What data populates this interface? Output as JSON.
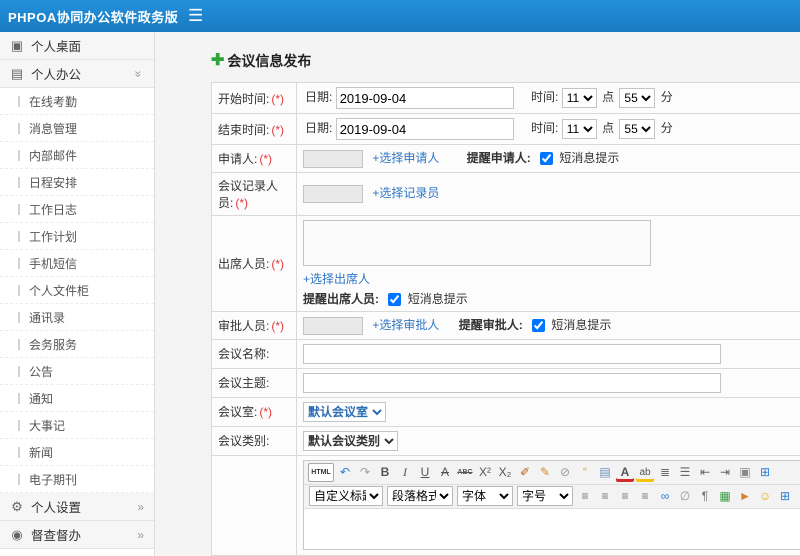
{
  "topbar": {
    "title": "PHPOA协同办公软件政务版"
  },
  "sidebar": {
    "desktop": "个人桌面",
    "office": "个人办公",
    "items": [
      {
        "label": "在线考勤"
      },
      {
        "label": "消息管理"
      },
      {
        "label": "内部邮件"
      },
      {
        "label": "日程安排"
      },
      {
        "label": "工作日志"
      },
      {
        "label": "工作计划"
      },
      {
        "label": "手机短信"
      },
      {
        "label": "个人文件柜"
      },
      {
        "label": "通讯录"
      },
      {
        "label": "会务服务"
      },
      {
        "label": "公告"
      },
      {
        "label": "通知"
      },
      {
        "label": "大事记"
      },
      {
        "label": "新闻"
      },
      {
        "label": "电子期刊"
      }
    ],
    "settings": "个人设置",
    "supervision": "督查督办"
  },
  "main": {
    "page_title": "会议信息发布",
    "form": {
      "start_time": {
        "label": "开始时间:",
        "req": "(*)",
        "date_label": "日期:",
        "date": "2019-09-04",
        "time_label": "时间:",
        "hour": "11",
        "hour_unit": "点",
        "minute": "55",
        "minute_unit": "分"
      },
      "end_time": {
        "label": "结束时间:",
        "req": "(*)",
        "date_label": "日期:",
        "date": "2019-09-04",
        "time_label": "时间:",
        "hour": "11",
        "hour_unit": "点",
        "minute": "55",
        "minute_unit": "分"
      },
      "applicant": {
        "label": "申请人:",
        "req": "(*)",
        "link": "+选择申请人",
        "remind": "提醒申请人:",
        "sms": "短消息提示"
      },
      "recorder": {
        "label": "会议记录人员:",
        "req": "(*)",
        "link": "+选择记录员"
      },
      "attendees": {
        "label": "出席人员:",
        "req": "(*)",
        "link": "+选择出席人",
        "remind": "提醒出席人员:",
        "sms": "短消息提示"
      },
      "approver": {
        "label": "审批人员:",
        "req": "(*)",
        "link": "+选择审批人",
        "remind": "提醒审批人:",
        "sms": "短消息提示"
      },
      "meeting_name": {
        "label": "会议名称:"
      },
      "meeting_subject": {
        "label": "会议主题:"
      },
      "meeting_room": {
        "label": "会议室:",
        "req": "(*)",
        "value": "默认会议室"
      },
      "meeting_type": {
        "label": "会议类别:",
        "value": "默认会议类别"
      }
    },
    "editor": {
      "toolbar_row1": [
        {
          "n": "html-source-icon",
          "g": "HTML",
          "cls": "tb-html"
        },
        {
          "n": "undo-icon",
          "g": "↶",
          "c": "#2a7fd4"
        },
        {
          "n": "redo-icon",
          "g": "↷",
          "c": "#9aa0a6"
        },
        {
          "n": "bold-icon",
          "g": "B",
          "cls": "tb-bold"
        },
        {
          "n": "italic-icon",
          "g": "I",
          "cls": "tb-italic"
        },
        {
          "n": "underline-icon",
          "g": "U",
          "cls": "tb-underline"
        },
        {
          "n": "strikethrough-icon",
          "g": "A",
          "cls": "tb-strike"
        },
        {
          "n": "spellcheck-icon",
          "g": "ABC",
          "cls": "tb-abc"
        },
        {
          "n": "superscript-icon",
          "g": "X²"
        },
        {
          "n": "subscript-icon",
          "g": "X₂"
        },
        {
          "n": "eraser-icon",
          "g": "✐",
          "c": "#b5651d"
        },
        {
          "n": "format-painter-icon",
          "g": "✎",
          "c": "#d98b2b"
        },
        {
          "n": "remove-format-icon",
          "g": "⊘",
          "c": "#999"
        },
        {
          "n": "blockquote-icon",
          "g": "“",
          "c": "#caa53d"
        },
        {
          "n": "insert-date-icon",
          "g": "▤",
          "c": "#6a8fbf"
        },
        {
          "n": "font-color-icon",
          "g": "A",
          "cls": "tb-fc"
        },
        {
          "n": "highlight-color-icon",
          "g": "ab",
          "cls": "tb-bc"
        },
        {
          "n": "ordered-list-icon",
          "g": "≣",
          "c": "#666"
        },
        {
          "n": "unordered-list-icon",
          "g": "☰",
          "c": "#666"
        },
        {
          "n": "outdent-icon",
          "g": "⇤",
          "c": "#666"
        },
        {
          "n": "indent-icon",
          "g": "⇥",
          "c": "#666"
        },
        {
          "n": "paste-text-icon",
          "g": "▣",
          "c": "#888"
        },
        {
          "n": "fullscreen-icon",
          "g": "⊞",
          "c": "#2a7fd4"
        }
      ],
      "toolbar_selects": {
        "heading": "自定义标题",
        "paragraph": "段落格式",
        "font": "字体",
        "size": "字号"
      },
      "toolbar_row2": [
        {
          "n": "align-left-icon",
          "g": "≡",
          "c": "#777"
        },
        {
          "n": "align-center-icon",
          "g": "≡",
          "c": "#777"
        },
        {
          "n": "align-right-icon",
          "g": "≡",
          "c": "#777"
        },
        {
          "n": "justify-icon",
          "g": "≡",
          "c": "#777"
        },
        {
          "n": "link-icon",
          "g": "∞",
          "c": "#2a7fd4"
        },
        {
          "n": "unlink-icon",
          "g": "∅",
          "c": "#999"
        },
        {
          "n": "anchor-icon",
          "g": "¶",
          "c": "#777"
        },
        {
          "n": "image-icon",
          "g": "▦",
          "c": "#3a9d46"
        },
        {
          "n": "media-icon",
          "g": "►",
          "c": "#d9822b"
        },
        {
          "n": "emoticon-icon",
          "g": "☺",
          "c": "#e6a817"
        },
        {
          "n": "table-icon",
          "g": "⊞",
          "c": "#2a7fd4"
        },
        {
          "n": "map-icon",
          "g": "⊡",
          "c": "#2a7fd4"
        }
      ]
    }
  }
}
